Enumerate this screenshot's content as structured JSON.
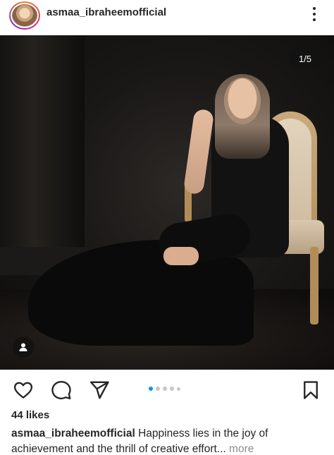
{
  "header": {
    "username": "asmaa_ibraheemofficial",
    "avatar_icon": "profile-avatar",
    "more_icon": "vertical-ellipsis-icon"
  },
  "post": {
    "image_counter": "1/5",
    "tag_icon": "user-tag-icon",
    "current_image": 1,
    "total_images": 5
  },
  "actions": {
    "like_icon": "heart-icon",
    "comment_icon": "comment-bubble-icon",
    "share_icon": "paper-plane-icon",
    "save_icon": "bookmark-icon"
  },
  "likes": "44 likes",
  "caption": {
    "username": "asmaa_ibraheemofficial",
    "text": "Happiness lies in the joy of achievement and the thrill of creative effort",
    "ellipsis": "...",
    "more_label": "more"
  },
  "colors": {
    "accent": "#0095f6",
    "text": "#262626",
    "muted": "#8e8e8e"
  }
}
